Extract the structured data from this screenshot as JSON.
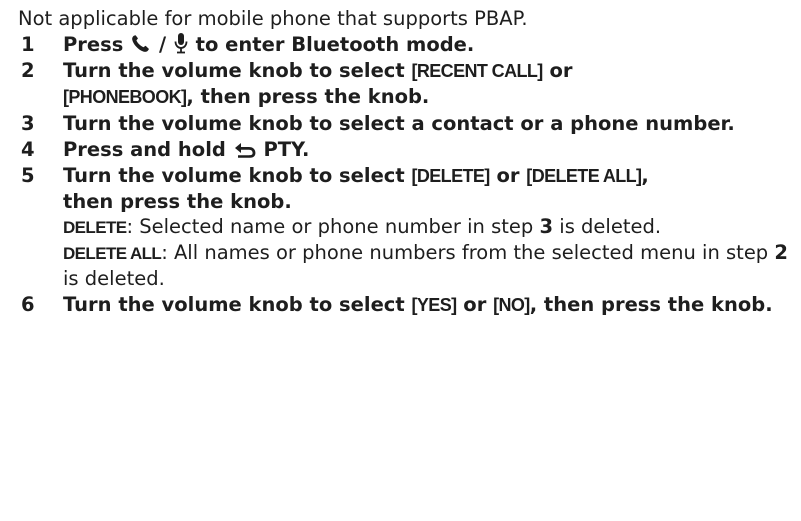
{
  "intro": "Not applicable for mobile phone that supports PBAP.",
  "step1": {
    "num": "1",
    "press": "Press",
    "slash": "/",
    "rest": "to enter Bluetooth mode."
  },
  "step2": {
    "num": "2",
    "a": "Turn the volume knob to select",
    "opt1": "[RECENT CALL]",
    "or": "or",
    "opt2": "[PHONEBOOK]",
    "b": ", then press the knob."
  },
  "step3": {
    "num": "3",
    "text": "Turn the volume knob to select a contact or a phone number."
  },
  "step4": {
    "num": "4",
    "text": "Press and hold",
    "button": "PTY",
    "end": "."
  },
  "step5": {
    "num": "5",
    "a": "Turn the volume knob to select",
    "opt1": "[DELETE]",
    "or": "or",
    "opt2": "[DELETE ALL]",
    "b": ",",
    "c": "then press the knob.",
    "note1": {
      "term": "DELETE",
      "text": ": Selected name or phone number in step",
      "ref": "3",
      "end": "is deleted."
    },
    "note2": {
      "term": "DELETE ALL",
      "text": ": All names or phone numbers from the selected menu in step",
      "ref": "2",
      "end": "is deleted."
    }
  },
  "step6": {
    "num": "6",
    "a": "Turn the volume knob to select",
    "opt1": "[YES]",
    "or": "or",
    "opt2": "[NO]",
    "b": ", then press the knob."
  },
  "icons": [
    "phone-icon",
    "microphone-icon",
    "back-arrow-icon"
  ],
  "colors": {
    "text": "#1e1e1e",
    "background": "#ffffff"
  }
}
